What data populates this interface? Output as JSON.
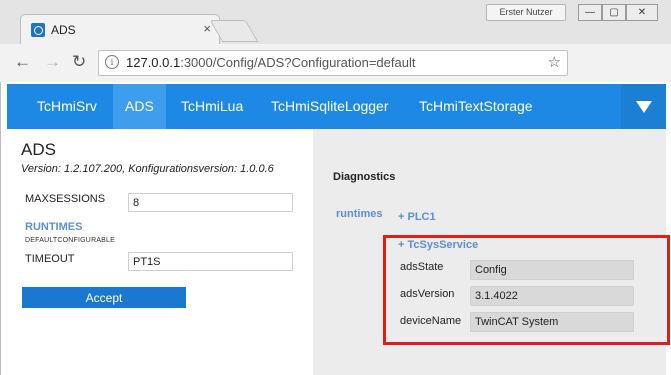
{
  "browser": {
    "tab_title": "ADS",
    "tab_close": "×",
    "user_badge": "Erster Nutzer",
    "window_controls": {
      "minimize": "—",
      "maximize": "▢",
      "close": "✕"
    },
    "url_host": "127.0.0.1",
    "url_rest": ":3000/Config/ADS?Configuration=default",
    "icons": {
      "back": "arrow-left-icon",
      "forward": "arrow-right-icon",
      "reload": "reload-icon",
      "info": "info-icon",
      "bookmark": "star-icon",
      "menu": "menu-dots-icon"
    }
  },
  "app": {
    "nav_items": [
      {
        "label": "TcHmiSrv",
        "active": false
      },
      {
        "label": "ADS",
        "active": true
      },
      {
        "label": "TcHmiLua",
        "active": false
      },
      {
        "label": "TcHmiSqliteLogger",
        "active": false
      },
      {
        "label": "TcHmiTextStorage",
        "active": false
      }
    ],
    "accent_color": "#1e88e5"
  },
  "config": {
    "title": "ADS",
    "version": "Version: 1.2.107.200, Konfigurationsversion: 1.0.0.6",
    "maxsessions_label": "MAXSESSIONS",
    "maxsessions_value": "8",
    "runtimes_label": "RUNTIMES",
    "default_configurable": "DEFAULTCONFIGURABLE",
    "timeout_label": "TIMEOUT",
    "timeout_value": "PT1S",
    "accept_label": "Accept"
  },
  "diagnostics": {
    "title": "Diagnostics",
    "runtimes_label": "runtimes",
    "nodes": [
      "+ PLC1",
      "+ TcSysService"
    ],
    "properties": [
      {
        "label": "adsState",
        "value": "Config"
      },
      {
        "label": "adsVersion",
        "value": "3.1.4022"
      },
      {
        "label": "deviceName",
        "value": "TwinCAT System"
      }
    ]
  }
}
